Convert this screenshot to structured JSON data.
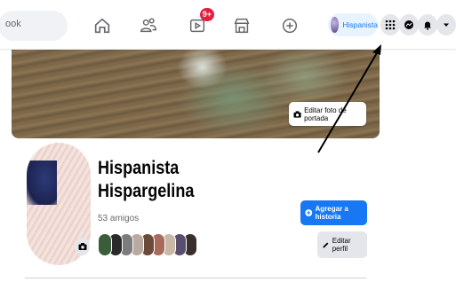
{
  "search": {
    "value": "ook"
  },
  "nav": {
    "home_icon": "home-icon",
    "friends_icon": "friends-icon",
    "watch_icon": "video-icon",
    "watch_badge": "9+",
    "marketplace_icon": "marketplace-icon",
    "gaming_icon": "gaming-icon"
  },
  "profile_chip": {
    "name": "Hispanista"
  },
  "actions": {
    "menu_icon": "grid-menu-icon",
    "messenger_icon": "messenger-icon",
    "notifications_icon": "bell-icon",
    "account_icon": "caret-down-icon"
  },
  "cover": {
    "edit_label": "Editar foto de portada"
  },
  "profile": {
    "name_line1": "Hispanista",
    "name_line2": "Hispargelina",
    "friends_count": "53 amigos"
  },
  "buttons": {
    "add_story": "Agregar a historia",
    "edit_profile": "Editar perfil"
  },
  "colors": {
    "accent": "#1877f2",
    "badge": "#e41e3f",
    "button_grey": "#e4e6eb",
    "annotation_arrow": "#000000"
  },
  "friend_avatar_colors": [
    "#3b5d3a",
    "#2a2a2a",
    "#7c7c7c",
    "#b9a9a0",
    "#6b4a3a",
    "#a86a5a",
    "#c8b8a8",
    "#5a4e6e",
    "#3a2f2f"
  ]
}
